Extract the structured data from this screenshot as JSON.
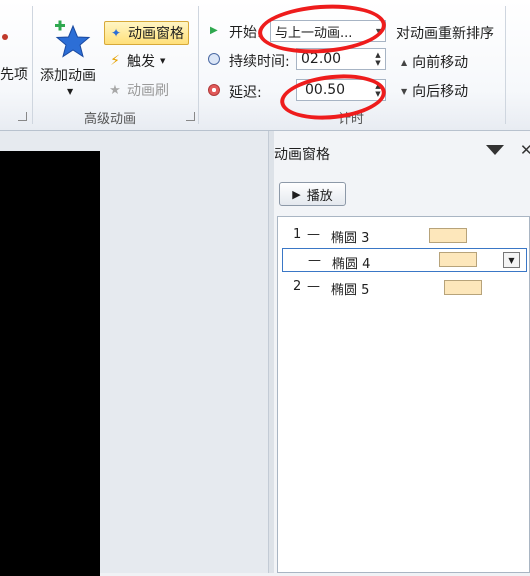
{
  "ribbon": {
    "options_partial_label": "先项",
    "add_animation_label": "添加动画",
    "animation_pane_label": "动画窗格",
    "trigger_label": "触发",
    "animation_painter_label": "动画刷",
    "advanced_group_label": "高级动画",
    "start_label": "开始:",
    "start_value": "与上一动画...",
    "duration_label": "持续时间:",
    "duration_value": "02.00",
    "delay_label": "延迟:",
    "delay_value": "00.50",
    "reorder_title": "对动画重新排序",
    "move_earlier_label": "向前移动",
    "move_later_label": "向后移动",
    "timing_group_label": "计时"
  },
  "pane": {
    "title": "动画窗格",
    "play_label": "播放",
    "items": [
      {
        "num": "1",
        "dash": "—",
        "name": "椭圆 3",
        "bar_color": "#fde7bb"
      },
      {
        "num": "",
        "dash": "—",
        "name": "椭圆 4",
        "bar_color": "#fde7bb"
      },
      {
        "num": "2",
        "dash": "—",
        "name": "椭圆 5",
        "bar_color": "#fde7bb"
      }
    ]
  },
  "colors": {
    "annotation_red": "#ee1c1c",
    "selection_blue": "#3a77c6",
    "active_button": "#ffe07a"
  }
}
